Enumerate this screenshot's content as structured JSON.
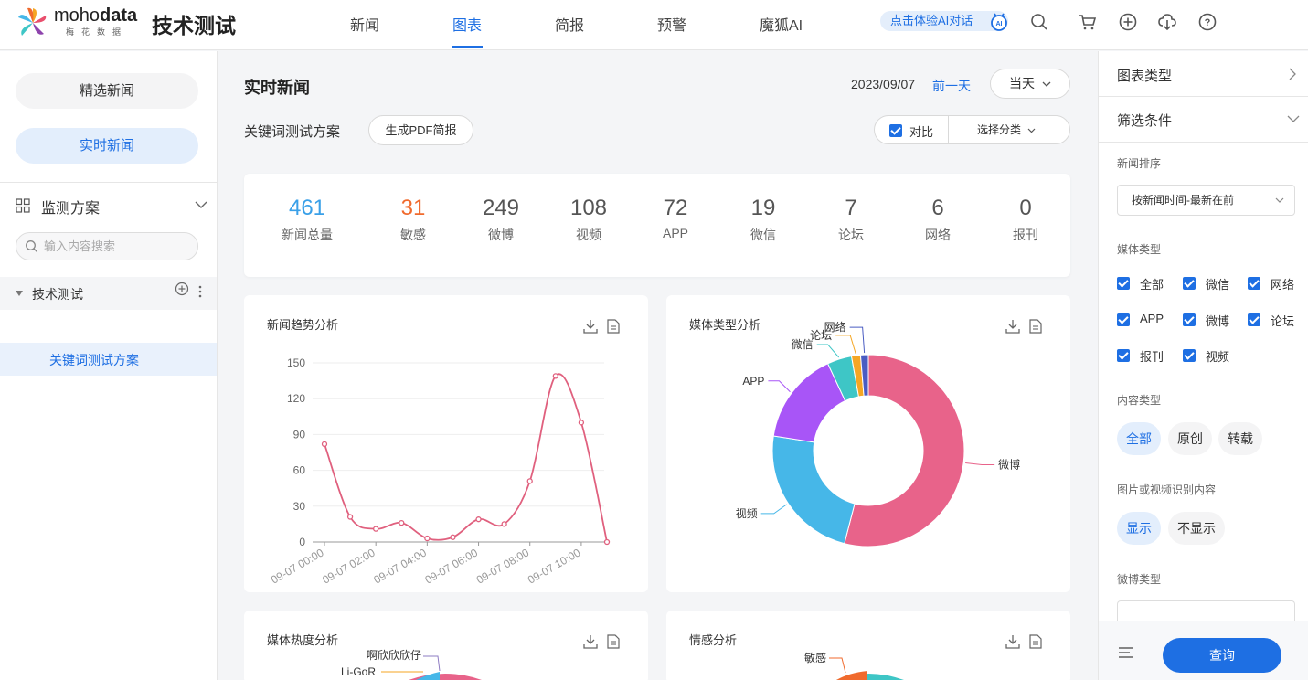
{
  "header": {
    "logo_text_a": "moho",
    "logo_text_b": "data",
    "logo_sub": "梅花数据",
    "brand_title": "技术测试",
    "nav": [
      "新闻",
      "图表",
      "简报",
      "预警",
      "魔狐AI"
    ],
    "active_nav": "图表",
    "ai_chat": "点击体验AI对话",
    "icons": [
      "ai-robot-icon",
      "search-icon",
      "cart-icon",
      "plus-circle-icon",
      "download-cloud-icon",
      "help-icon"
    ]
  },
  "sidebar": {
    "featured_news": "精选新闻",
    "realtime_news": "实时新闻",
    "monitor_plans": "监测方案",
    "search_placeholder": "输入内容搜索",
    "tree_root": "技术测试",
    "tree_child": "关键词测试方案"
  },
  "main": {
    "title": "实时新闻",
    "date": "2023/09/07",
    "prev_day": "前一天",
    "today": "当天",
    "plan_name": "关键词测试方案",
    "pdf_button": "生成PDF简报",
    "compare": "对比",
    "select_category": "选择分类",
    "stats": [
      {
        "value": "461",
        "label": "新闻总量",
        "color": "#3aa0e8"
      },
      {
        "value": "31",
        "label": "敏感",
        "color": "#f06a2d"
      },
      {
        "value": "249",
        "label": "微博",
        "color": "#555555"
      },
      {
        "value": "108",
        "label": "视频",
        "color": "#555555"
      },
      {
        "value": "72",
        "label": "APP",
        "color": "#555555"
      },
      {
        "value": "19",
        "label": "微信",
        "color": "#555555"
      },
      {
        "value": "7",
        "label": "论坛",
        "color": "#555555"
      },
      {
        "value": "6",
        "label": "网络",
        "color": "#555555"
      },
      {
        "value": "0",
        "label": "报刊",
        "color": "#555555"
      }
    ],
    "cards": {
      "trend": "新闻趋势分析",
      "media_type": "媒体类型分析",
      "media_heat": "媒体热度分析",
      "sentiment": "情感分析"
    },
    "heat_labels": [
      "啊欣欣欣仔",
      "Li-GoR"
    ],
    "sentiment_labels": [
      "敏感"
    ]
  },
  "chart_data": [
    {
      "type": "line",
      "title": "新闻趋势分析",
      "x_ticks": [
        "09-07 00:00",
        "09-07 02:00",
        "09-07 04:00",
        "09-07 06:00",
        "09-07 08:00",
        "09-07 10:00"
      ],
      "y_ticks": [
        0,
        30,
        60,
        90,
        120,
        150
      ],
      "ylim": [
        0,
        150
      ],
      "x": [
        "00:00",
        "01:00",
        "02:00",
        "03:00",
        "04:00",
        "05:00",
        "06:00",
        "07:00",
        "08:00",
        "09:00",
        "10:00",
        "11:00"
      ],
      "values": [
        82,
        21,
        11,
        16,
        3,
        4,
        19,
        15,
        51,
        139,
        100,
        0
      ],
      "color": "#e0607e",
      "grid": true
    },
    {
      "type": "pie",
      "title": "媒体类型分析",
      "donut": true,
      "labels": [
        "微博",
        "视频",
        "APP",
        "微信",
        "论坛",
        "网络"
      ],
      "values": [
        249,
        108,
        72,
        19,
        7,
        6
      ],
      "colors": [
        "#e8638a",
        "#46b7e8",
        "#a855f7",
        "#3ec6c6",
        "#f5a623",
        "#4a5cc2"
      ]
    }
  ],
  "rpanel": {
    "chart_type": "图表类型",
    "filter": "筛选条件",
    "sort_label": "新闻排序",
    "sort_value": "按新闻时间-最新在前",
    "media_type_label": "媒体类型",
    "media_checks": [
      "全部",
      "微信",
      "网络",
      "APP",
      "微博",
      "论坛",
      "报刊",
      "视频"
    ],
    "content_type_label": "内容类型",
    "content_types": [
      "全部",
      "原创",
      "转载"
    ],
    "ocr_label": "图片或视频识别内容",
    "ocr_options": [
      "显示",
      "不显示"
    ],
    "weibo_type_label": "微博类型",
    "query": "查询"
  }
}
